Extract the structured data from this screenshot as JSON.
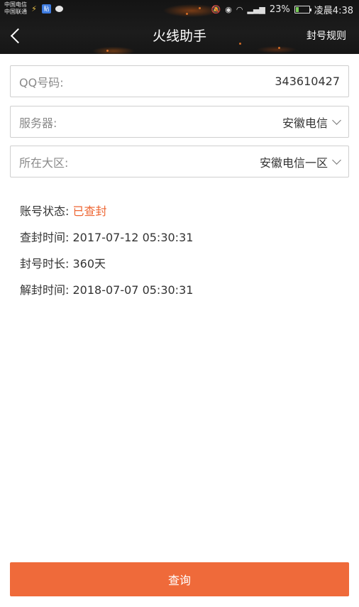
{
  "status_bar": {
    "carrier_1": "中国电信",
    "carrier_2": "中国联通",
    "tieba_badge": "贴",
    "battery": "23%",
    "time": "凌晨4:38",
    "battery_level": 0.23,
    "icons": [
      "bolt-icon",
      "tieba-icon",
      "chat-icon",
      "mute-icon",
      "eye-icon",
      "wifi-icon",
      "signal-icon",
      "battery-icon"
    ]
  },
  "header": {
    "title": "火线助手",
    "rules_link": "封号规则"
  },
  "form": {
    "qq": {
      "label": "QQ号码:",
      "value": "343610427"
    },
    "server": {
      "label": "服务器:",
      "value": "安徽电信"
    },
    "region": {
      "label": "所在大区:",
      "value": "安徽电信一区"
    }
  },
  "result": {
    "account_status": {
      "label": "账号状态:",
      "value": "已查封"
    },
    "ban_time": {
      "label": "查封时间:",
      "value": "2017-07-12 05:30:31"
    },
    "ban_duration": {
      "label": "封号时长:",
      "value": "360天"
    },
    "unban_time": {
      "label": "解封时间:",
      "value": "2018-07-07 05:30:31"
    }
  },
  "query_button": "查询",
  "colors": {
    "accent": "#ef6a3a",
    "status_banned": "#ee6633",
    "header_bg": "#1a1a1a"
  }
}
